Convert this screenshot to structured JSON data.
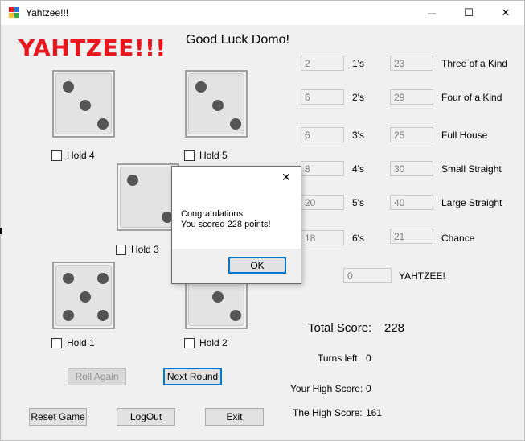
{
  "window": {
    "title": "Yahtzee!!!",
    "minimize_glyph": "—",
    "maximize_glyph": "☐",
    "close_glyph": "✕"
  },
  "logo": "YAHTZEE!!!",
  "greeting": "Good Luck Domo!",
  "holds": {
    "hold1": "Hold 1",
    "hold2": "Hold 2",
    "hold3": "Hold 3",
    "hold4": "Hold 4",
    "hold5": "Hold 5"
  },
  "upper": [
    {
      "value": "2",
      "label": "1's"
    },
    {
      "value": "6",
      "label": "2's"
    },
    {
      "value": "6",
      "label": "3's"
    },
    {
      "value": "8",
      "label": "4's"
    },
    {
      "value": "20",
      "label": "5's"
    },
    {
      "value": "18",
      "label": "6's"
    }
  ],
  "lower": [
    {
      "value": "23",
      "label": "Three of a Kind"
    },
    {
      "value": "29",
      "label": "Four of a Kind"
    },
    {
      "value": "25",
      "label": "Full House"
    },
    {
      "value": "30",
      "label": "Small Straight"
    },
    {
      "value": "40",
      "label": "Large Straight"
    },
    {
      "value": "21",
      "label": "Chance"
    }
  ],
  "yahtzee": {
    "value": "0",
    "label": "YAHTZEE!"
  },
  "total": {
    "label": "Total Score:",
    "value": "228"
  },
  "turns": {
    "label": "Turns left:",
    "value": "0"
  },
  "your_high": {
    "label": "Your High Score:",
    "value": "0"
  },
  "the_high": {
    "label": "The High Score:",
    "value": "161"
  },
  "buttons": {
    "roll_again": "Roll Again",
    "next_round": "Next Round",
    "reset_game": "Reset Game",
    "logout": "LogOut",
    "exit": "Exit"
  },
  "dialog": {
    "line1": "Congratulations!",
    "line2": "You scored 228 points!",
    "ok": "OK",
    "close_glyph": "✕"
  },
  "colors": {
    "logo": "#e8171e",
    "focus": "#0078d7"
  }
}
